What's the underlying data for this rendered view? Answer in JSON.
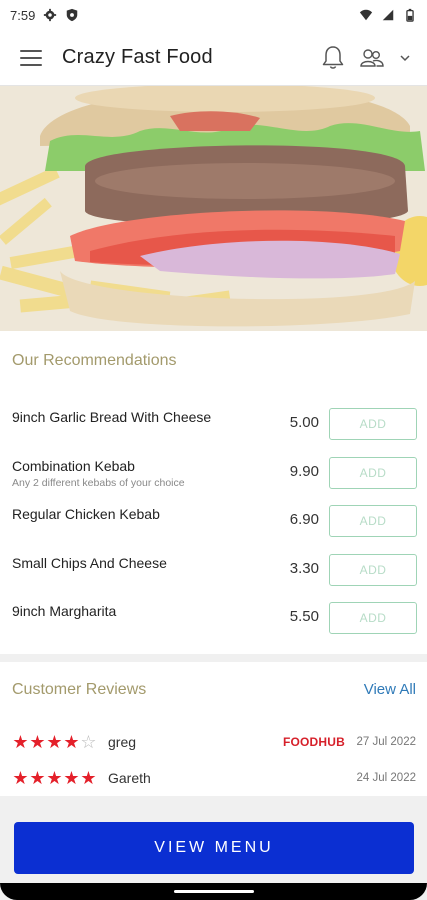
{
  "status_bar": {
    "time": "7:59",
    "icons": [
      "gear-icon",
      "shield-icon",
      "wifi-icon",
      "signal-icon",
      "battery-icon"
    ]
  },
  "header": {
    "title": "Crazy Fast Food",
    "icons": [
      "menu-icon",
      "bell-icon",
      "people-icon",
      "chevron-down-icon"
    ]
  },
  "hero": {
    "image": "burger-and-fries"
  },
  "recommendations": {
    "title": "Our Recommendations",
    "items": [
      {
        "name": "9inch Garlic Bread With Cheese",
        "description": "",
        "price": "5.00",
        "action": "ADD"
      },
      {
        "name": "Combination Kebab",
        "description": "Any 2 different kebabs of your choice",
        "price": "9.90",
        "action": "ADD"
      },
      {
        "name": "Regular Chicken Kebab",
        "description": "",
        "price": "6.90",
        "action": "ADD"
      },
      {
        "name": "Small Chips And Cheese",
        "description": "",
        "price": "3.30",
        "action": "ADD"
      },
      {
        "name": "9inch Margharita",
        "description": "",
        "price": "5.50",
        "action": "ADD"
      }
    ]
  },
  "reviews": {
    "title": "Customer Reviews",
    "view_all": "View All",
    "items": [
      {
        "rating": 4,
        "max": 5,
        "name": "greg",
        "source": "FOODHUB",
        "date": "27 Jul 2022"
      },
      {
        "rating": 5,
        "max": 5,
        "name": "Gareth",
        "source": "",
        "date": "24 Jul 2022"
      }
    ]
  },
  "footer": {
    "button": "VIEW MENU"
  },
  "colors": {
    "accent_gold": "#a39a6c",
    "primary_button": "#0b2fd2",
    "star": "#e4202a",
    "add_border": "#9fd4b6",
    "link": "#2f7ab8"
  }
}
